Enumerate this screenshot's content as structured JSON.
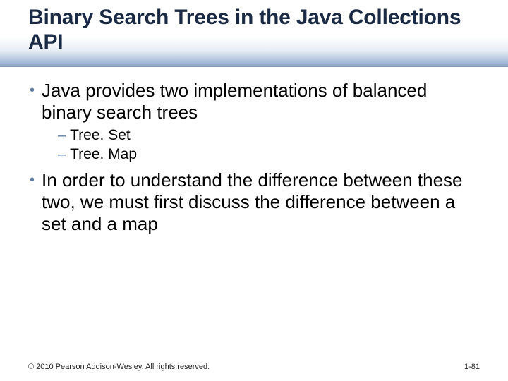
{
  "title": "Binary Search Trees in the Java Collections API",
  "bullets": [
    {
      "text": "Java provides two implementations of balanced binary search trees",
      "sub": [
        "Tree. Set",
        "Tree. Map"
      ]
    },
    {
      "text": "In order to understand the difference between these two, we must first discuss the difference between a set and a map",
      "sub": []
    }
  ],
  "footer": {
    "copyright": "© 2010 Pearson Addison-Wesley. All rights reserved.",
    "page": "1-81"
  }
}
